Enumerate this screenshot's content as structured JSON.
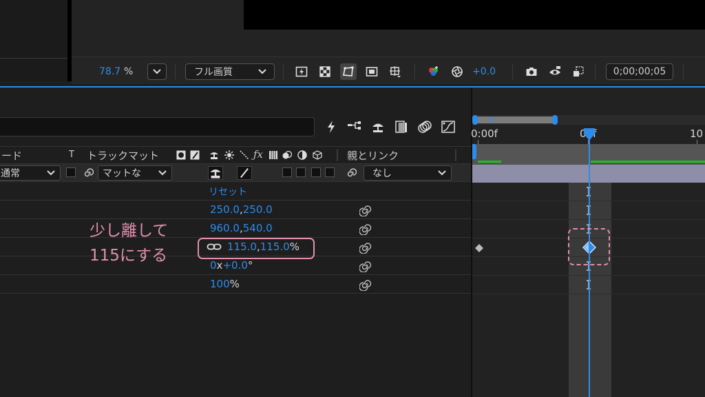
{
  "viewer": {
    "zoom_value": "78.7",
    "zoom_unit": "%",
    "resolution": "フル画質",
    "exposure": "+0.0",
    "timecode": "0;00;00;05"
  },
  "timeline": {
    "columns": {
      "mode": "ード",
      "t": "T",
      "track_matte": "トラックマット",
      "parent_link": "親とリンク"
    },
    "layer": {
      "mode_value": "通常",
      "matte_value": "マットな",
      "parent_value": "なし"
    },
    "properties": {
      "reset_label": "リセット",
      "anchor_a": "250.0",
      "anchor_sep": ",",
      "anchor_b": "250.0",
      "position_a": "960.0",
      "position_sep": ",",
      "position_b": "540.0",
      "scale_a": "115.0",
      "scale_sep": ",",
      "scale_b": "115.0",
      "scale_unit": "%",
      "rotation_a": "0",
      "rotation_x": "x",
      "rotation_b": "+0.0",
      "rotation_deg": "°",
      "opacity_value": "100",
      "opacity_unit": "%"
    },
    "annotation": {
      "line1": "少し離して",
      "line2": "115にする"
    },
    "ruler": {
      "label_0": "0:00f",
      "label_05": "05f",
      "label_10": "10"
    }
  },
  "colors": {
    "accent_blue": "#2d8ceb",
    "annotation_pink": "#e48fb0",
    "green_bar": "#1fbf1f",
    "layer_bar": "#8e8ea8"
  }
}
